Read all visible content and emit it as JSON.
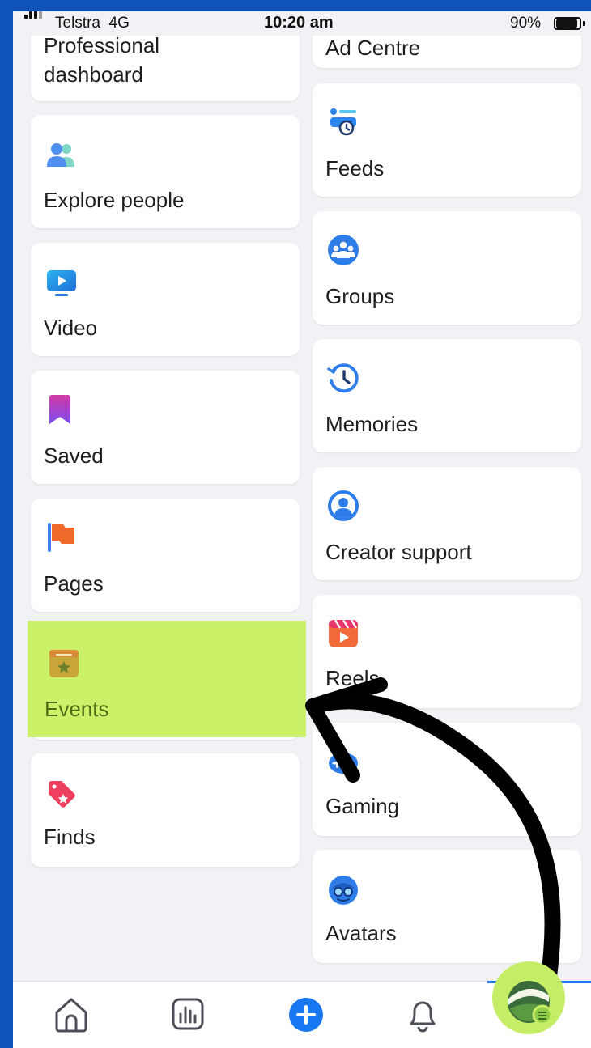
{
  "status_bar": {
    "carrier": "Telstra",
    "network": "4G",
    "time": "10:20 am",
    "battery": "90%"
  },
  "left_column": [
    {
      "id": "professional-dashboard",
      "label_top": "Professional",
      "label": "dashboard",
      "icon": "none"
    },
    {
      "id": "explore-people",
      "label": "Explore people",
      "icon": "people-icon"
    },
    {
      "id": "video",
      "label": "Video",
      "icon": "video-icon"
    },
    {
      "id": "saved",
      "label": "Saved",
      "icon": "bookmark-icon"
    },
    {
      "id": "pages",
      "label": "Pages",
      "icon": "flag-icon"
    },
    {
      "id": "events",
      "label": "Events",
      "icon": "calendar-star-icon",
      "highlighted": true
    },
    {
      "id": "finds",
      "label": "Finds",
      "icon": "tag-icon"
    }
  ],
  "right_column": [
    {
      "id": "ad-centre",
      "label": "Ad Centre",
      "icon": "none"
    },
    {
      "id": "feeds",
      "label": "Feeds",
      "icon": "feeds-icon"
    },
    {
      "id": "groups",
      "label": "Groups",
      "icon": "groups-icon"
    },
    {
      "id": "memories",
      "label": "Memories",
      "icon": "clock-icon"
    },
    {
      "id": "creator-support",
      "label": "Creator support",
      "icon": "person-circle-icon"
    },
    {
      "id": "reels",
      "label": "Reels",
      "icon": "reels-icon"
    },
    {
      "id": "gaming",
      "label": "Gaming",
      "icon": "gamepad-icon"
    },
    {
      "id": "avatars",
      "label": "Avatars",
      "icon": "avatar-icon"
    }
  ],
  "tab_bar": [
    {
      "id": "home",
      "icon": "home-icon"
    },
    {
      "id": "dashboard",
      "icon": "chart-icon"
    },
    {
      "id": "create",
      "icon": "plus-circle-icon"
    },
    {
      "id": "notifications",
      "icon": "bell-icon"
    },
    {
      "id": "menu",
      "icon": "profile-menu-icon",
      "active": true
    }
  ],
  "colors": {
    "accent": "#1877f2",
    "highlight": "#c8f05c",
    "background": "#f0f2f5"
  }
}
